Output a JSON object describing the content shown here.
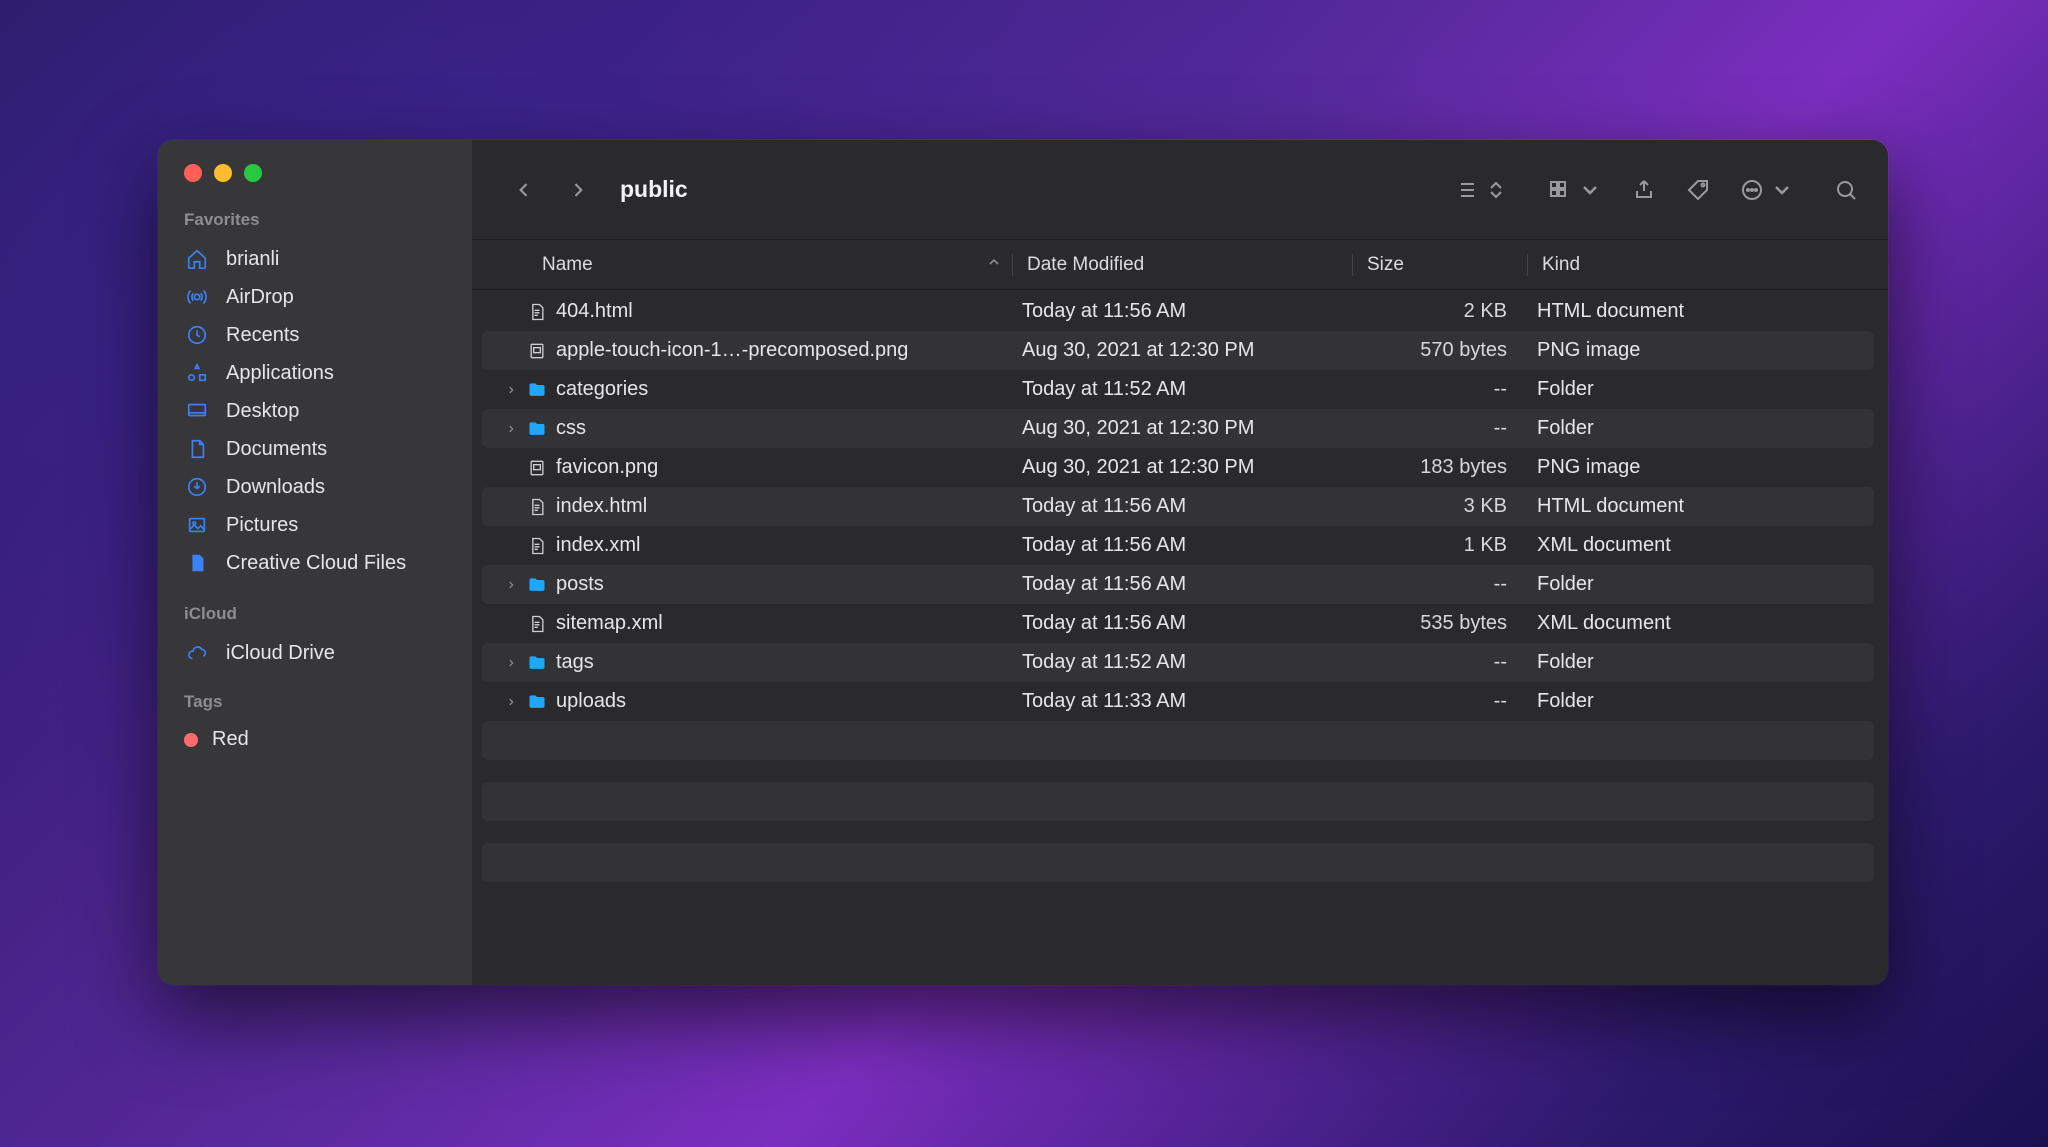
{
  "window": {
    "title": "public"
  },
  "sidebar": {
    "sections": [
      {
        "heading": "Favorites",
        "items": [
          {
            "label": "brianli",
            "icon": "home"
          },
          {
            "label": "AirDrop",
            "icon": "airdrop"
          },
          {
            "label": "Recents",
            "icon": "clock"
          },
          {
            "label": "Applications",
            "icon": "apps"
          },
          {
            "label": "Desktop",
            "icon": "desktop"
          },
          {
            "label": "Documents",
            "icon": "doc"
          },
          {
            "label": "Downloads",
            "icon": "download"
          },
          {
            "label": "Pictures",
            "icon": "pictures"
          },
          {
            "label": "Creative Cloud Files",
            "icon": "ccfile"
          }
        ]
      },
      {
        "heading": "iCloud",
        "items": [
          {
            "label": "iCloud Drive",
            "icon": "cloud"
          }
        ]
      },
      {
        "heading": "Tags",
        "tags": [
          {
            "label": "Red",
            "color": "#ff6b6b"
          }
        ]
      }
    ]
  },
  "columns": {
    "name": "Name",
    "date": "Date Modified",
    "size": "Size",
    "kind": "Kind",
    "sort": "name_asc"
  },
  "files": [
    {
      "name": "404.html",
      "date": "Today at 11:56 AM",
      "size": "2 KB",
      "kind": "HTML document",
      "type": "doc",
      "expandable": false
    },
    {
      "name": "apple-touch-icon-1…-precomposed.png",
      "date": "Aug 30, 2021 at 12:30 PM",
      "size": "570 bytes",
      "kind": "PNG image",
      "type": "img",
      "expandable": false
    },
    {
      "name": "categories",
      "date": "Today at 11:52 AM",
      "size": "--",
      "kind": "Folder",
      "type": "folder",
      "expandable": true
    },
    {
      "name": "css",
      "date": "Aug 30, 2021 at 12:30 PM",
      "size": "--",
      "kind": "Folder",
      "type": "folder",
      "expandable": true
    },
    {
      "name": "favicon.png",
      "date": "Aug 30, 2021 at 12:30 PM",
      "size": "183 bytes",
      "kind": "PNG image",
      "type": "img",
      "expandable": false
    },
    {
      "name": "index.html",
      "date": "Today at 11:56 AM",
      "size": "3 KB",
      "kind": "HTML document",
      "type": "doc",
      "expandable": false
    },
    {
      "name": "index.xml",
      "date": "Today at 11:56 AM",
      "size": "1 KB",
      "kind": "XML document",
      "type": "doc",
      "expandable": false
    },
    {
      "name": "posts",
      "date": "Today at 11:56 AM",
      "size": "--",
      "kind": "Folder",
      "type": "folder",
      "expandable": true
    },
    {
      "name": "sitemap.xml",
      "date": "Today at 11:56 AM",
      "size": "535 bytes",
      "kind": "XML document",
      "type": "doc",
      "expandable": false
    },
    {
      "name": "tags",
      "date": "Today at 11:52 AM",
      "size": "--",
      "kind": "Folder",
      "type": "folder",
      "expandable": true
    },
    {
      "name": "uploads",
      "date": "Today at 11:33 AM",
      "size": "--",
      "kind": "Folder",
      "type": "folder",
      "expandable": true
    }
  ]
}
